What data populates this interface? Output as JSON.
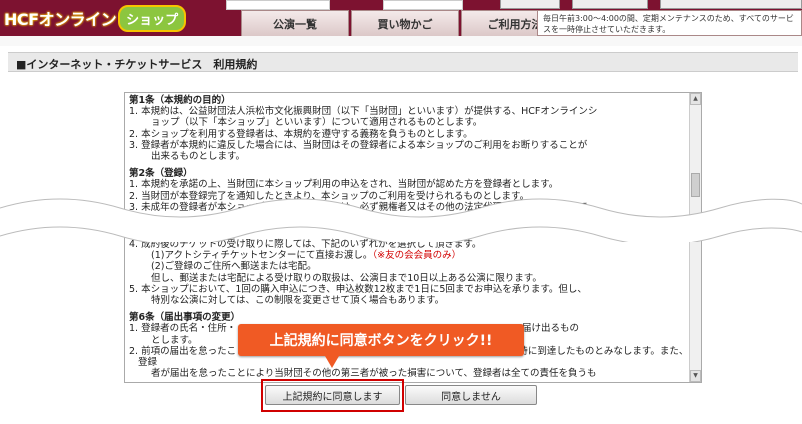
{
  "header": {
    "logo_text": "HCFオンライン",
    "logo_badge": "ショップ",
    "nav": [
      "公演一覧",
      "買い物かご",
      "ご利用方法"
    ],
    "notice": "毎日午前3:00〜4:00の間、定期メンテナンスのため、すべてのサービスを一時停止させていただきます。"
  },
  "title": "■インターネット・チケットサービス　利用規約",
  "terms": {
    "sections": [
      {
        "title": "第1条（本規約の目的）",
        "lines": [
          {
            "text": "1. 本規約は、公益財団法人浜松市文化振興財団（以下「当財団」といいます）が提供する、HCFオンラインシ",
            "cls": "item"
          },
          {
            "text": "ョップ（以下「本ショップ」といいます）について適用されるものとします。",
            "cls": "item cont"
          },
          {
            "text": "2. 本ショップを利用する登録者は、本規約を遵守する義務を負うものとします。",
            "cls": "item"
          },
          {
            "text": "3. 登録者が本規約に違反した場合には、当財団はその登録者による本ショップのご利用をお断りすることが",
            "cls": "item"
          },
          {
            "text": "出来るものとします。",
            "cls": "item cont"
          }
        ]
      },
      {
        "title": "第2条（登録）",
        "lines": [
          {
            "text": "1. 本規約を承諾の上、当財団に本ショップ利用の申込をされ、当財団が認めた方を登録者とします。",
            "cls": "item"
          },
          {
            "text": "2. 当財団が本登録完了を通知したときより、本ショップのご利用を受けられるものとします。",
            "cls": "item"
          },
          {
            "text": "3. 未成年の登録者が本ショップを利用する場合には、必ず親権者又はその他の法定代理人の方の同意を得て",
            "cls": "item"
          }
        ]
      }
    ],
    "lower_lines": [
      {
        "text": "4. 成約後のチケットの受け取りに際しては、下記のいずれかを選択して頂きます。",
        "cls": "item"
      },
      {
        "text": "(1)アクトシティチケットセンターにて直接お渡し。",
        "red": "（※友の会会員のみ）",
        "cls": "item cont"
      },
      {
        "text": "(2)ご登録のご住所へ郵送または宅配。",
        "cls": "item cont"
      },
      {
        "text": "但し、郵送または宅配による受け取りの取扱は、公演日まで10日以上ある公演に限ります。",
        "cls": "item cont"
      },
      {
        "text": "5. 本ショップにおいて、1回の購入申込につき、申込枚数12枚まで1日に5回までお申込を承ります。但し、",
        "cls": "item"
      },
      {
        "text": "特別な公演に対しては、この制限を変更させて頂く場合もあります。",
        "cls": "item cont"
      }
    ],
    "section6": {
      "title": "第6条（届出事項の変更）",
      "lines": [
        {
          "text": "1. 登録者の氏名・住所・",
          "tail": "届け出るもの",
          "cls": "item"
        },
        {
          "text": "とします。",
          "cls": "item cont"
        },
        {
          "text": "2. 前項の届出を怠ったことにより、当財団からの通知が不到達となっても、通常到達すべき時に到達したものとみなします。また、登録",
          "cls": "item"
        },
        {
          "text": "者が届出を怠ったことにより当財団その他の第三者が被った損害について、登録者は全ての責任を負うも",
          "cls": "item cont"
        }
      ]
    }
  },
  "callout": "上記規約に同意ボタンをクリック!!",
  "buttons": {
    "agree": "上記規約に同意します",
    "disagree": "同意しません"
  }
}
